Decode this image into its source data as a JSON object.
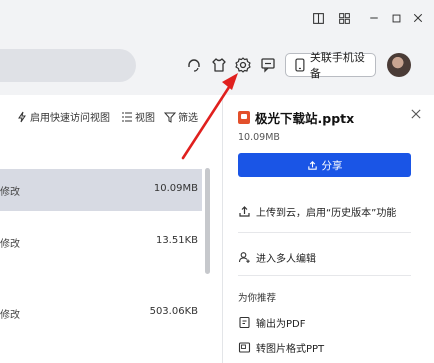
{
  "header": {
    "phone_device_label": "关联手机设备",
    "icons": [
      "headset-icon",
      "skin-icon",
      "settings-icon",
      "message-icon",
      "phone-icon"
    ]
  },
  "window": {
    "controls": [
      "layout-icon",
      "grid-icon",
      "minimize-icon",
      "maximize-icon",
      "close-icon"
    ]
  },
  "file_list": {
    "actions": {
      "quick_access": "启用快速访问视图",
      "view": "视图",
      "filter": "筛选"
    },
    "rows": [
      {
        "name": "修改",
        "size": "10.09MB",
        "selected": true
      },
      {
        "name": "修改",
        "size": "13.51KB",
        "selected": false
      },
      {
        "name": "修改",
        "size": "503.06KB",
        "selected": false
      }
    ]
  },
  "detail_panel": {
    "file_name": "极光下载站.pptx",
    "file_size": "10.09MB",
    "share_label": "分享",
    "upload_label": "上传到云，启用“历史版本”功能",
    "collab_label": "进入多人编辑",
    "recommend_title": "为你推荐",
    "export_pdf_label": "输出为PDF",
    "image_ppt_label": "转图片格式PPT"
  },
  "colors": {
    "accent": "#1a55e6",
    "ppt_icon": "#e3502b",
    "annotation_arrow": "#e0201e"
  }
}
